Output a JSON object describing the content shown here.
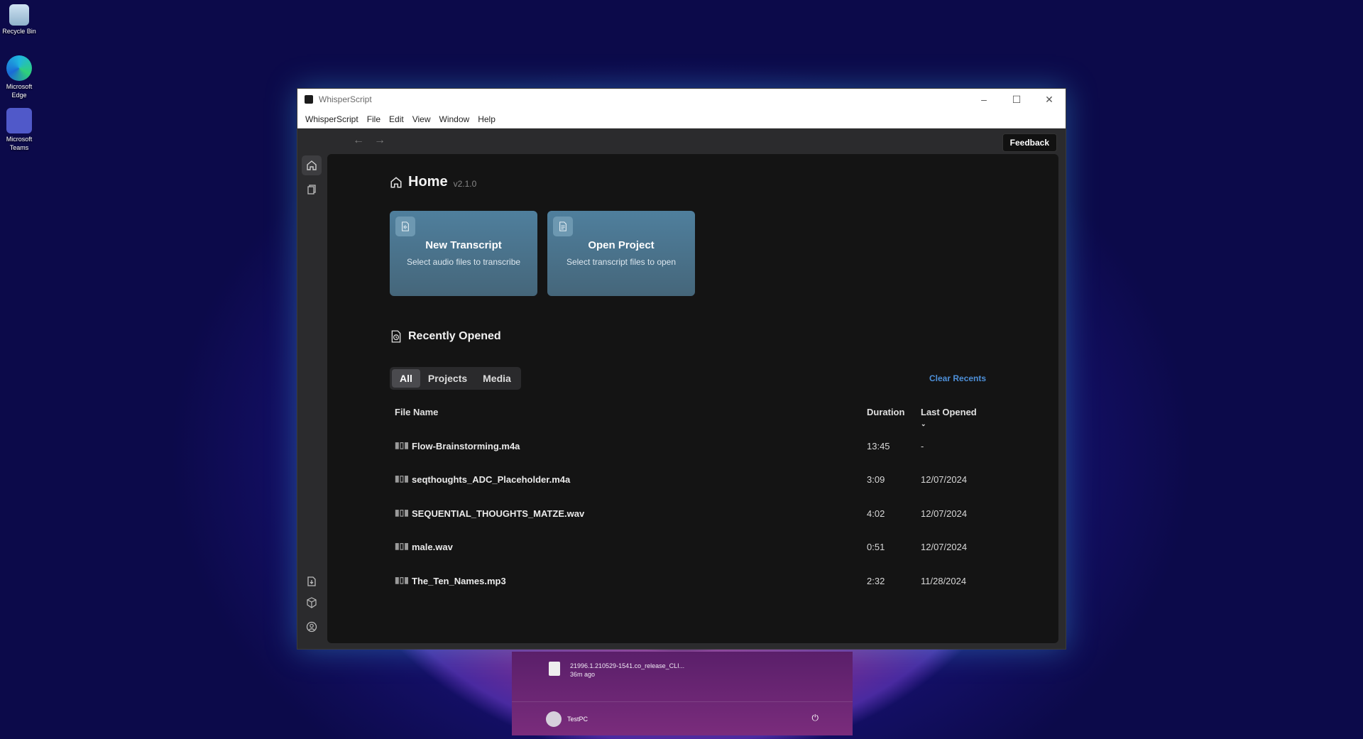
{
  "desktop": {
    "icons": [
      {
        "label": "Recycle Bin",
        "icon": "recycle-bin-icon"
      },
      {
        "label": "Microsoft Edge",
        "icon": "edge-icon"
      },
      {
        "label": "Microsoft Teams",
        "icon": "teams-icon"
      }
    ]
  },
  "window": {
    "title": "WhisperScript",
    "menu": [
      "WhisperScript",
      "File",
      "Edit",
      "View",
      "Window",
      "Help"
    ],
    "feedback_label": "Feedback"
  },
  "home": {
    "title": "Home",
    "version": "v2.1.0",
    "cards": [
      {
        "title": "New Transcript",
        "subtitle": "Select audio files to transcribe"
      },
      {
        "title": "Open Project",
        "subtitle": "Select transcript files to open"
      }
    ],
    "recent_title": "Recently Opened",
    "filters": [
      "All",
      "Projects",
      "Media"
    ],
    "active_filter": "All",
    "clear_label": "Clear Recents",
    "columns": {
      "name": "File Name",
      "duration": "Duration",
      "last_opened": "Last Opened"
    },
    "rows": [
      {
        "name": "Flow-Brainstorming.m4a",
        "duration": "13:45",
        "last_opened": "-"
      },
      {
        "name": "seqthoughts_ADC_Placeholder.m4a",
        "duration": "3:09",
        "last_opened": "12/07/2024"
      },
      {
        "name": "SEQUENTIAL_THOUGHTS_MATZE.wav",
        "duration": "4:02",
        "last_opened": "12/07/2024"
      },
      {
        "name": "male.wav",
        "duration": "0:51",
        "last_opened": "12/07/2024"
      },
      {
        "name": "The_Ten_Names.mp3",
        "duration": "2:32",
        "last_opened": "11/28/2024"
      }
    ]
  },
  "taskbar_popup": {
    "file_name": "21996.1.210529-1541.co_release_CLI...",
    "file_time": "36m ago",
    "user": "TestPC"
  }
}
